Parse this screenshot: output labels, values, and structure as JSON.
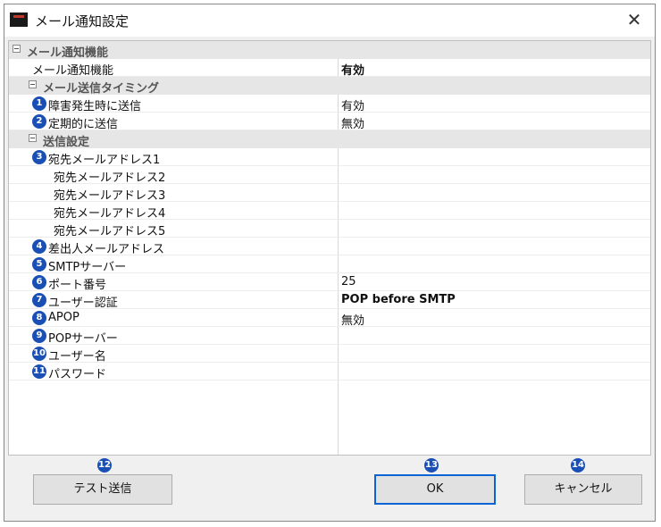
{
  "window": {
    "title": "メール通知設定",
    "close_label": "✕"
  },
  "grid": {
    "cat_main": "メール通知機能",
    "row_notify_label": "メール通知機能",
    "row_notify_value": "有効",
    "cat_timing": "メール送信タイミング",
    "row_fault_label": "障害発生時に送信",
    "row_fault_value": "有効",
    "row_periodic_label": "定期的に送信",
    "row_periodic_value": "無効",
    "cat_send": "送信設定",
    "row_to1_label": "宛先メールアドレス1",
    "row_to2_label": "宛先メールアドレス2",
    "row_to3_label": "宛先メールアドレス3",
    "row_to4_label": "宛先メールアドレス4",
    "row_to5_label": "宛先メールアドレス5",
    "row_from_label": "差出人メールアドレス",
    "row_smtp_label": "SMTPサーバー",
    "row_port_label": "ポート番号",
    "row_port_value": "25",
    "row_auth_label": "ユーザー認証",
    "row_auth_value": "POP before SMTP",
    "row_apop_label": "APOP",
    "row_apop_value": "無効",
    "row_pop_label": "POPサーバー",
    "row_user_label": "ユーザー名",
    "row_pass_label": "パスワード"
  },
  "badges": [
    "1",
    "2",
    "3",
    "4",
    "5",
    "6",
    "7",
    "8",
    "9",
    "10",
    "11",
    "12",
    "13",
    "14"
  ],
  "buttons": {
    "test": "テスト送信",
    "ok": "OK",
    "cancel": "キャンセル"
  },
  "colors": {
    "badge": "#1a4fb5",
    "category_bg": "#e6e6e6",
    "ok_border": "#0a64d6"
  }
}
